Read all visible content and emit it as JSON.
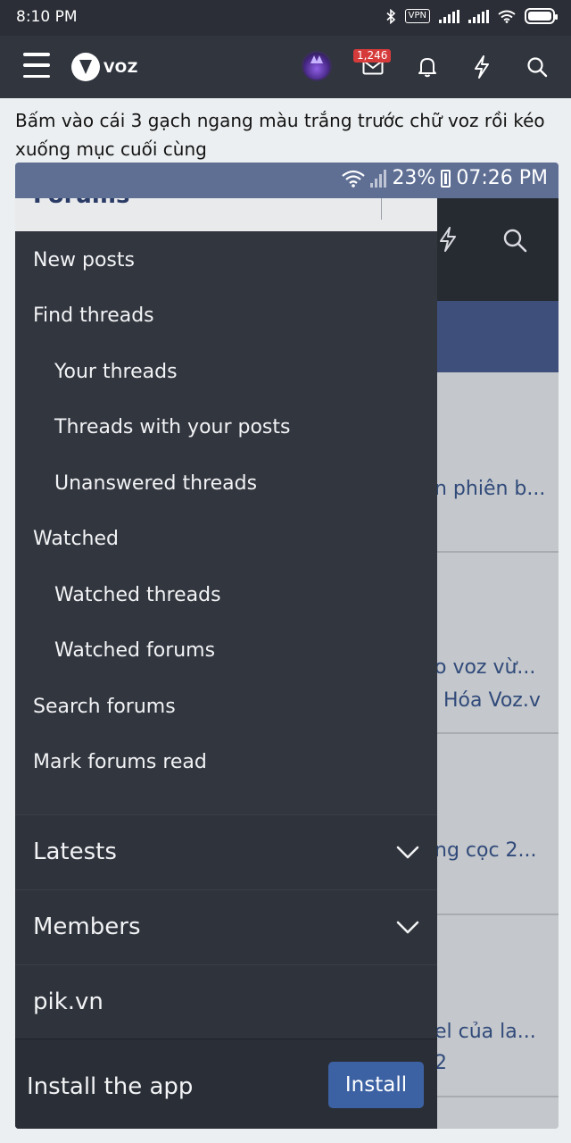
{
  "status_bar": {
    "time": "8:10 PM",
    "vpn_label": "VPN"
  },
  "app_bar": {
    "logo_text": "VOZ",
    "notification_badge": "1,246"
  },
  "post": {
    "caption": "Bấm vào cái 3 gạch ngang màu trắng trước chữ voz rồi kéo xuống mục cuối cùng"
  },
  "screenshot": {
    "status": {
      "battery": "23%",
      "time": "07:26 PM"
    },
    "drawer": {
      "header_cut": "Forums",
      "items": [
        {
          "label": "New posts"
        },
        {
          "label": "Find threads"
        },
        {
          "label": "Your threads"
        },
        {
          "label": "Threads with your posts"
        },
        {
          "label": "Unanswered threads"
        },
        {
          "label": "Watched"
        },
        {
          "label": "Watched threads"
        },
        {
          "label": "Watched forums"
        },
        {
          "label": "Search forums"
        },
        {
          "label": "Mark forums read"
        }
      ],
      "categories": [
        {
          "label": "Latests"
        },
        {
          "label": "Members"
        },
        {
          "label": "pik.vn"
        }
      ],
      "install_label": "Install the app",
      "install_button": "Install"
    },
    "background_snippets": [
      "n phiên b...",
      "o voz vừ...",
      "Hóa Voz.v",
      "ng cọc 2...",
      "el của la...",
      "2"
    ]
  },
  "colors": {
    "app_bar": "#30353e",
    "drawer": "#32363f",
    "accent": "#3c62a3",
    "badge": "#d63b3b"
  },
  "icons": [
    "menu-icon",
    "voz-logo",
    "mail-icon",
    "bell-icon",
    "bolt-icon",
    "search-icon",
    "chevron-down-icon",
    "wifi-icon",
    "bluetooth-icon",
    "signal-icon",
    "battery-icon"
  ]
}
